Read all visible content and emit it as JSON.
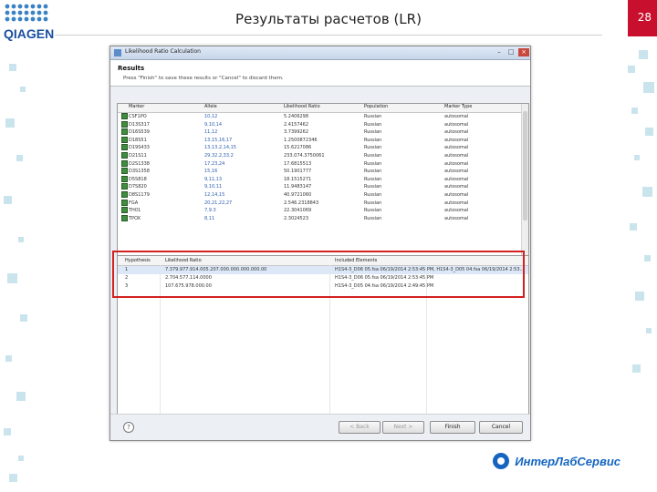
{
  "slide": {
    "title": "Результаты расчетов (LR)",
    "page_number": "28",
    "logo_text": "QIAGEN",
    "brand_text": "ИнтерЛабСервис",
    "accent_color": "#c8102e",
    "brand_color": "#1565c0"
  },
  "dialog": {
    "title": "Likelihood Ratio Calculation",
    "heading": "Results",
    "instruction": "Press \"Finish\" to save these results or \"Cancel\" to discard them.",
    "top_table": {
      "columns": [
        "Marker",
        "Allele",
        "Likelihood Ratio",
        "Population",
        "Marker Type"
      ],
      "rows": [
        {
          "marker": "CSF1PO",
          "allele": "10,12",
          "lr": "5.2406298",
          "population": "Russian",
          "type": "autosomal"
        },
        {
          "marker": "D13S317",
          "allele": "9,10,14",
          "lr": "2.4157462",
          "population": "Russian",
          "type": "autosomal"
        },
        {
          "marker": "D16S539",
          "allele": "11,12",
          "lr": "3.7399262",
          "population": "Russian",
          "type": "autosomal"
        },
        {
          "marker": "D18S51",
          "allele": "13,15,16,17",
          "lr": "1.2500872346",
          "population": "Russian",
          "type": "autosomal"
        },
        {
          "marker": "D19S433",
          "allele": "13,13.2,14,15",
          "lr": "15.6217086",
          "population": "Russian",
          "type": "autosomal"
        },
        {
          "marker": "D21S11",
          "allele": "29,32.2,33.2",
          "lr": "233.074.3750061",
          "population": "Russian",
          "type": "autosomal"
        },
        {
          "marker": "D2S1338",
          "allele": "17,23,24",
          "lr": "17.6815513",
          "population": "Russian",
          "type": "autosomal"
        },
        {
          "marker": "D3S1358",
          "allele": "15,16",
          "lr": "50.1901777",
          "population": "Russian",
          "type": "autosomal"
        },
        {
          "marker": "D5S818",
          "allele": "9,11,13",
          "lr": "18.1515271",
          "population": "Russian",
          "type": "autosomal"
        },
        {
          "marker": "D7S820",
          "allele": "9,10,11",
          "lr": "11.9483147",
          "population": "Russian",
          "type": "autosomal"
        },
        {
          "marker": "D8S1179",
          "allele": "12,14,15",
          "lr": "40.9721060",
          "population": "Russian",
          "type": "autosomal"
        },
        {
          "marker": "FGA",
          "allele": "20,21,22,27",
          "lr": "2.546.2318843",
          "population": "Russian",
          "type": "autosomal"
        },
        {
          "marker": "TH01",
          "allele": "7,9.3",
          "lr": "22.3041069",
          "population": "Russian",
          "type": "autosomal"
        },
        {
          "marker": "TPOX",
          "allele": "8,11",
          "lr": "2.3024523",
          "population": "Russian",
          "type": "autosomal"
        }
      ]
    },
    "bottom_table": {
      "columns": [
        "Hypothesis",
        "Likelihood Ratio",
        "Included Elements"
      ],
      "rows": [
        {
          "hyp": "1",
          "lr": "7.379.977.914.005.207.000.000.000.000.00",
          "elements": "H1S4-3_D06 05.fsa 06/19/2014 2:53:45 PM, H1S4-3_D05 04.fsa 06/19/2014 2:53..."
        },
        {
          "hyp": "2",
          "lr": "2.704.577.114.0000",
          "elements": "H1S4-3_D06 05.fsa 06/19/2014 2:53:45 PM"
        },
        {
          "hyp": "3",
          "lr": "107.675.978.000.00",
          "elements": "H1S4-3_D05 04.fsa 06/19/2014 2:49:45 PM"
        }
      ]
    },
    "buttons": {
      "help": "?",
      "back": "< Back",
      "next": "Next >",
      "finish": "Finish",
      "cancel": "Cancel"
    }
  }
}
